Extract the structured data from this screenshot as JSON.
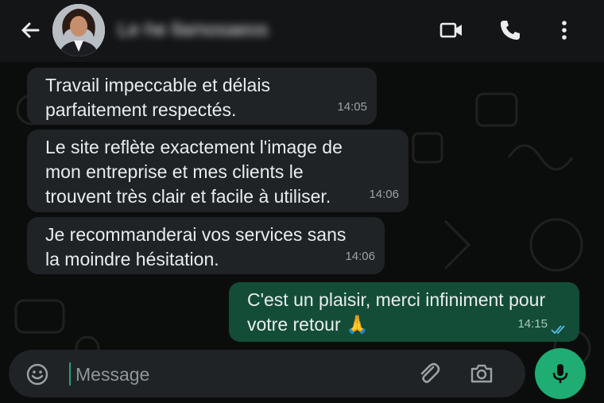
{
  "header": {
    "contact_name": "Le·he llamosaeos",
    "icons": [
      "arrow-back-icon",
      "video-call-icon",
      "phone-icon",
      "more-vertical-icon"
    ]
  },
  "messages": [
    {
      "direction": "in",
      "text": "Travail impeccable et délais\nparfaitement respectés.",
      "time": "14:05"
    },
    {
      "direction": "in",
      "text": "Le site reflète exactement l'image de\nmon entreprise et mes clients le\ntrouvent très clair et facile à utiliser.",
      "time": "14:06"
    },
    {
      "direction": "in",
      "text": "Je recommanderai vos services sans\nla moindre hésitation.",
      "time": "14:06"
    },
    {
      "direction": "out",
      "text": "C'est un plaisir, merci infiniment pour\nvotre retour 🙏",
      "time": "14:15",
      "status": "read"
    }
  ],
  "composer": {
    "placeholder": "Message",
    "value": ""
  },
  "colors": {
    "background": "#0b0d0c",
    "header": "#131516",
    "incoming_bubble": "#1f2326",
    "outgoing_bubble": "#134d37",
    "accent": "#1fad73",
    "read_ticks": "#53bdeb"
  }
}
